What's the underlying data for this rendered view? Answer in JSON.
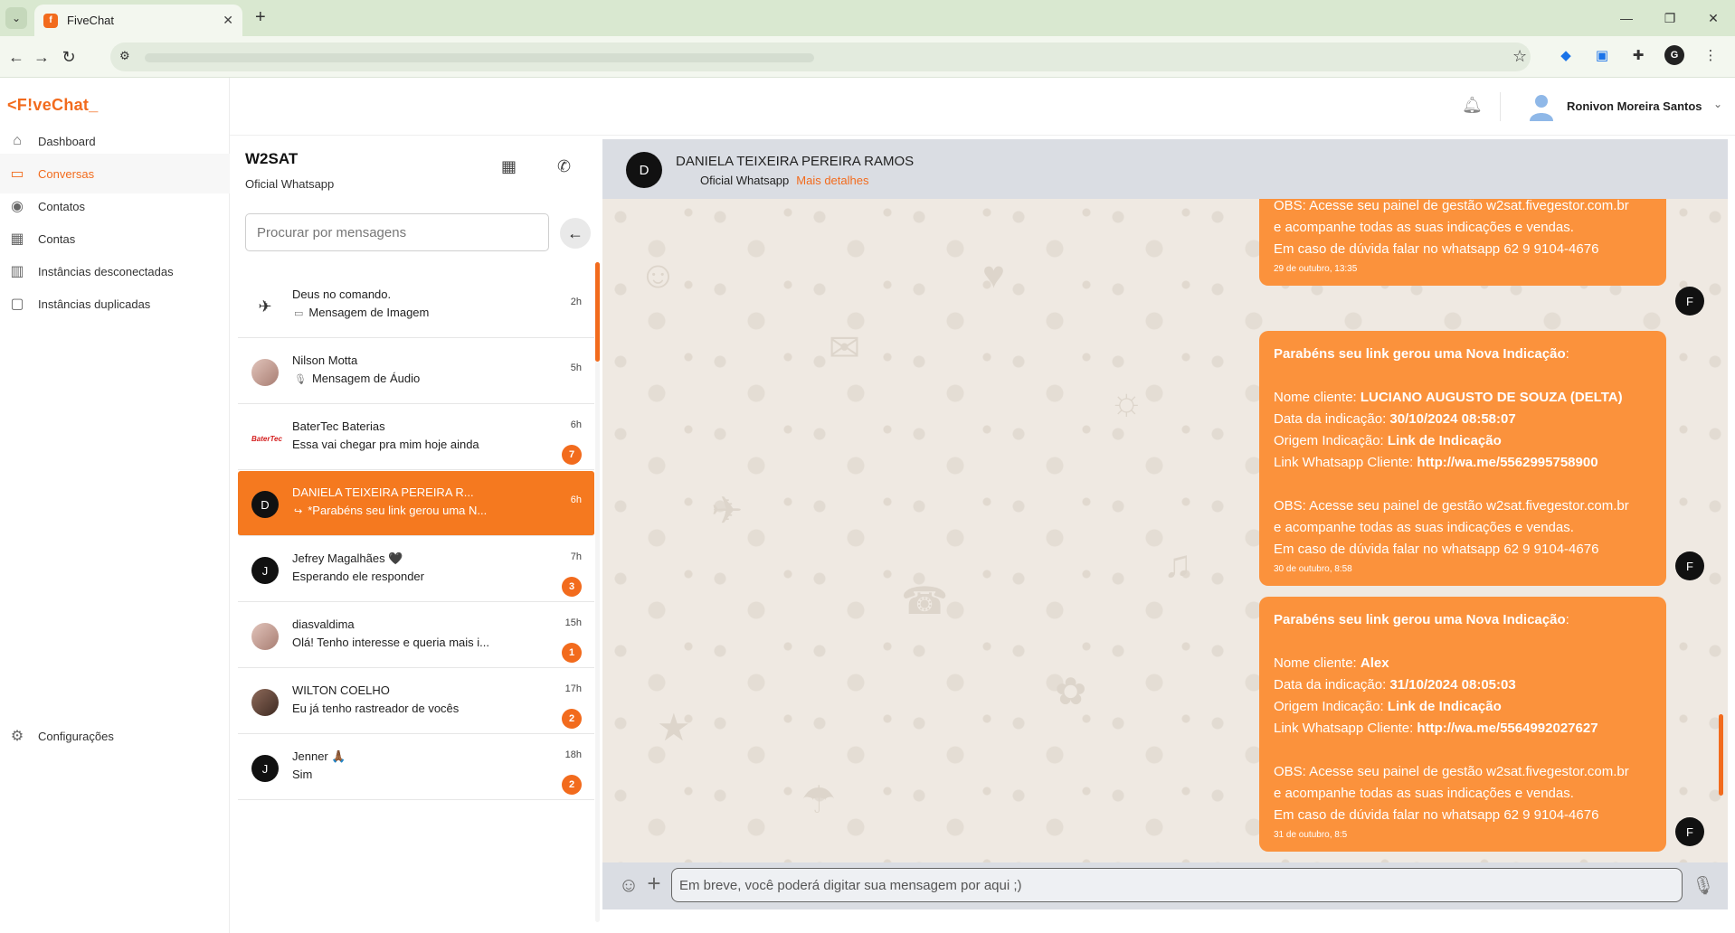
{
  "browser": {
    "tab_title": "FiveChat",
    "tab_close": "✕",
    "new_tab": "+",
    "controls": [
      "—",
      "❐",
      "✕"
    ]
  },
  "app": {
    "logo": "<F!veChat_",
    "nav": [
      {
        "label": "Dashboard",
        "icon": "home-icon"
      },
      {
        "label": "Conversas",
        "icon": "chat-icon"
      },
      {
        "label": "Contatos",
        "icon": "person-icon"
      },
      {
        "label": "Contas",
        "icon": "building-icon"
      },
      {
        "label": "Instâncias desconectadas",
        "icon": "bar-chart-icon"
      },
      {
        "label": "Instâncias duplicadas",
        "icon": "duplicate-chat-icon"
      }
    ],
    "settings_label": "Configurações",
    "user_name": "Ronivon Moreira Santos"
  },
  "list": {
    "instance_title": "W2SAT",
    "instance_subtitle": "Oficial Whatsapp",
    "search_placeholder": "Procurar por mensagens",
    "conversations": [
      {
        "name": "Deus no comando.",
        "message": "Mensagem de Imagem",
        "time": "2h",
        "badge": "",
        "avatar": ""
      },
      {
        "name": "Nilson Motta",
        "message": "Mensagem de Áudio",
        "time": "5h",
        "badge": "",
        "avatar": ""
      },
      {
        "name": "BaterTec Baterias",
        "message": "Essa vai chegar pra mim hoje ainda",
        "time": "6h",
        "badge": "7",
        "avatar": "BaterTec"
      },
      {
        "name": "DANIELA TEIXEIRA PEREIRA R...",
        "message": "*Parabéns seu link gerou uma N...",
        "time": "6h",
        "badge": "",
        "avatar": "D"
      },
      {
        "name": "Jefrey Magalhães 🖤",
        "message": "Esperando ele responder",
        "time": "7h",
        "badge": "3",
        "avatar": "J"
      },
      {
        "name": "diasvaldima",
        "message": "Olá! Tenho interesse e queria mais i...",
        "time": "15h",
        "badge": "1",
        "avatar": ""
      },
      {
        "name": "WILTON COELHO",
        "message": "Eu já tenho rastreador de vocês",
        "time": "17h",
        "badge": "2",
        "avatar": ""
      },
      {
        "name": "Jenner 🙏🏾",
        "message": "Sim",
        "time": "18h",
        "badge": "2",
        "avatar": "J"
      }
    ]
  },
  "chat": {
    "avatar": "D",
    "contact_name": "DANIELA TEIXEIRA PEREIRA RAMOS",
    "subtitle": "Oficial Whatsapp",
    "more_details": "Mais detalhes",
    "messages": [
      {
        "obs1": "OBS: Acesse seu painel de gestão w2sat.fivegestor.com.br",
        "obs2": "e acompanhe todas as suas indicações e vendas.",
        "obs3": "Em caso de dúvida falar no whatsapp 62 9 9104-4676",
        "timestamp": "29 de outubro, 13:35",
        "avatar": "F"
      },
      {
        "headline": "Parabéns seu link gerou uma Nova Indicação",
        "client_label": "Nome cliente: ",
        "client": "LUCIANO AUGUSTO DE SOUZA (DELTA)",
        "date_label": "Data da indicação: ",
        "date": "30/10/2024 08:58:07",
        "origin_label": "Origem Indicação: ",
        "origin": "Link de Indicação",
        "link_label": "Link Whatsapp Cliente: ",
        "link": "http://wa.me/5562995758900",
        "obs1": "OBS: Acesse seu painel de gestão w2sat.fivegestor.com.br",
        "obs2": "e acompanhe todas as suas indicações e vendas.",
        "obs3": "Em caso de dúvida falar no whatsapp 62 9 9104-4676",
        "timestamp": "30 de outubro, 8:58",
        "avatar": "F"
      },
      {
        "headline": "Parabéns seu link gerou uma Nova Indicação",
        "client_label": "Nome cliente: ",
        "client": "Alex",
        "date_label": "Data da indicação: ",
        "date": "31/10/2024 08:05:03",
        "origin_label": "Origem Indicação: ",
        "origin": "Link de Indicação",
        "link_label": "Link Whatsapp Cliente: ",
        "link": "http://wa.me/5564992027627",
        "obs1": "OBS: Acesse seu painel de gestão w2sat.fivegestor.com.br",
        "obs2": "e acompanhe todas as suas indicações e vendas.",
        "obs3": "Em caso de dúvida falar no whatsapp 62 9 9104-4676",
        "timestamp": "31 de outubro, 8:5",
        "avatar": "F"
      }
    ],
    "composer_placeholder": "Em breve, você poderá digitar sua mensagem por aqui ;)"
  },
  "colors": {
    "accent": "#f26b1d",
    "bubble": "#fb923c",
    "chat_bg": "#efe9e2",
    "chat_header": "#dadde3"
  }
}
